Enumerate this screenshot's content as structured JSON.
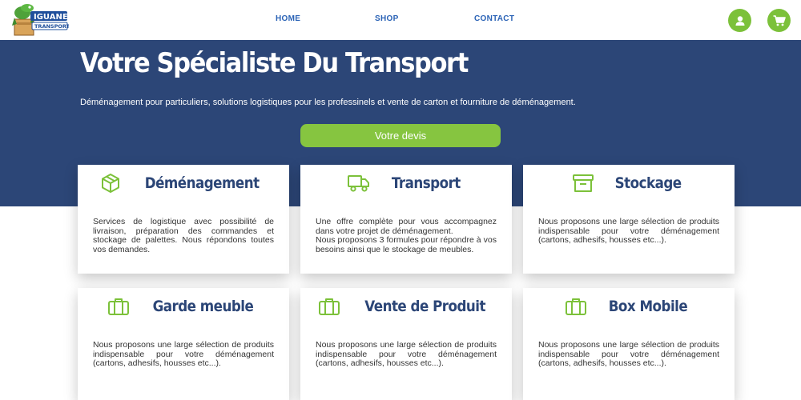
{
  "brand": {
    "logo_line1": "IGUANE",
    "logo_line2": "TRANSPORT"
  },
  "nav": {
    "home": "HOME",
    "shop": "SHOP",
    "contact": "CONTACT"
  },
  "header_icons": [
    "user-icon",
    "cart-icon"
  ],
  "hero": {
    "title": "Votre Spécialiste Du Transport",
    "subtitle": "Déménagement pour particuliers, solutions logistiques pour les professinels et vente de carton et fourniture de déménagement.",
    "cta_label": "Votre devis"
  },
  "colors": {
    "primary": "#2c4677",
    "accent": "#86c540",
    "nav_link": "#2b63b6"
  },
  "cards": [
    {
      "title": "Déménagement",
      "icon": "box-icon",
      "text": [
        "Services de logistique avec possibilité de livraison, préparation des commandes et stockage de palettes. Nous répondons toutes vos demandes."
      ]
    },
    {
      "title": "Transport",
      "icon": "truck-icon",
      "text": [
        "Une offre complète pour vous accompagnez dans votre projet de déménagement.",
        "Nous proposons 3 formules pour répondre à vos besoins ainsi que le stockage de meubles."
      ]
    },
    {
      "title": "Stockage",
      "icon": "archive-icon",
      "text": [
        "Nous proposons une large sélection de produits indispensable pour votre déménagement (cartons, adhesifs, housses etc...)."
      ]
    },
    {
      "title": "Garde meuble",
      "icon": "suitcase-icon",
      "text": [
        "Nous proposons une large sélection de produits indispensable pour votre déménagement (cartons, adhesifs, housses etc...)."
      ]
    },
    {
      "title": "Vente de Produit",
      "icon": "suitcase-icon",
      "text": [
        "Nous proposons une large sélection de produits indispensable pour votre déménagement (cartons, adhesifs, housses etc...)."
      ]
    },
    {
      "title": "Box Mobile",
      "icon": "suitcase-icon",
      "text": [
        "Nous proposons une large sélection de produits indispensable pour votre déménagement (cartons, adhesifs, housses etc...)."
      ]
    }
  ]
}
